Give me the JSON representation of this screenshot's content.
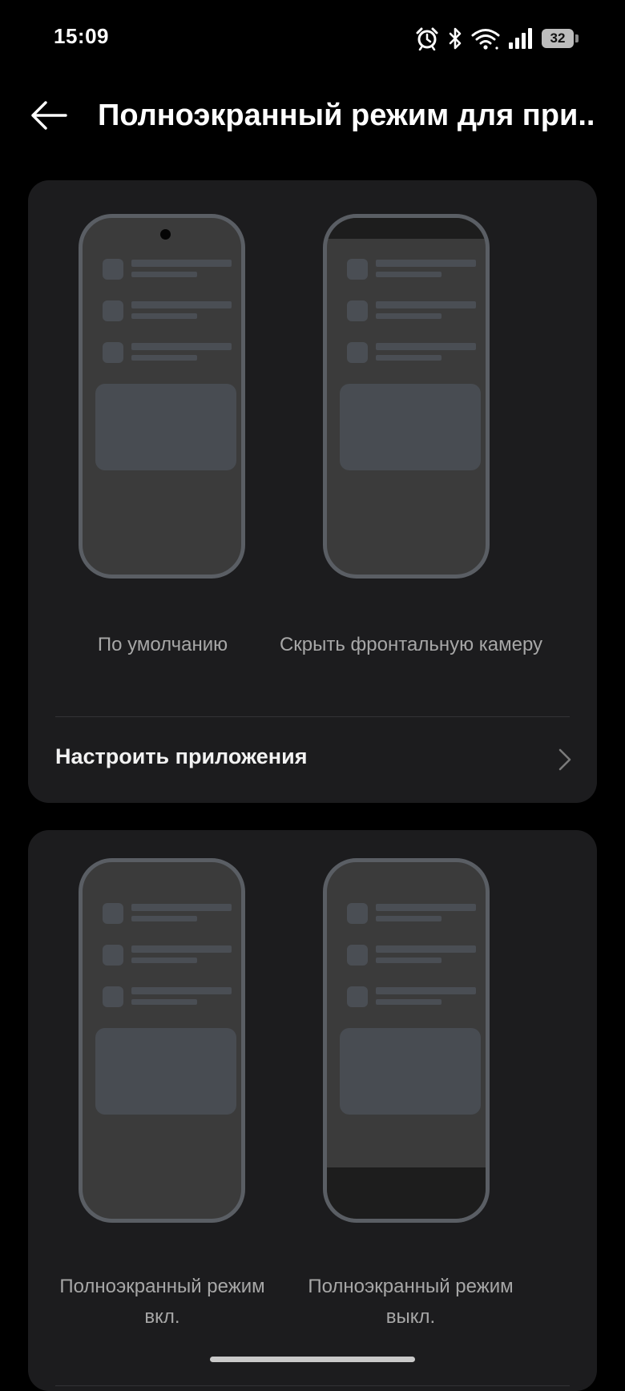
{
  "status_bar": {
    "time": "15:09",
    "icons": [
      "alarm-icon",
      "bluetooth-icon",
      "wifi-icon",
      "signal-icon",
      "battery-icon"
    ],
    "battery_percent": "32"
  },
  "header": {
    "back_icon": "arrow-left-icon",
    "title": "Полноэкранный режим для при..."
  },
  "sections": [
    {
      "options": [
        {
          "label": "По умолчанию",
          "phone_style": "default-with-camera"
        },
        {
          "label": "Скрыть фронтальную камеру",
          "phone_style": "hide-front-camera"
        }
      ],
      "row": {
        "label": "Настроить приложения",
        "icon": "chevron-right-icon"
      }
    },
    {
      "options": [
        {
          "label": "Полноэкранный режим вкл.",
          "phone_style": "fullscreen-on"
        },
        {
          "label": "Полноэкранный режим выкл.",
          "phone_style": "fullscreen-off"
        }
      ]
    }
  ],
  "colors": {
    "background": "#000000",
    "card": "#1c1c1e",
    "phone_frame": "#5a5e64",
    "phone_screen": "#3b3b3b",
    "placeholder": "#4a4e54",
    "secondary_text": "#a7a7a7"
  }
}
